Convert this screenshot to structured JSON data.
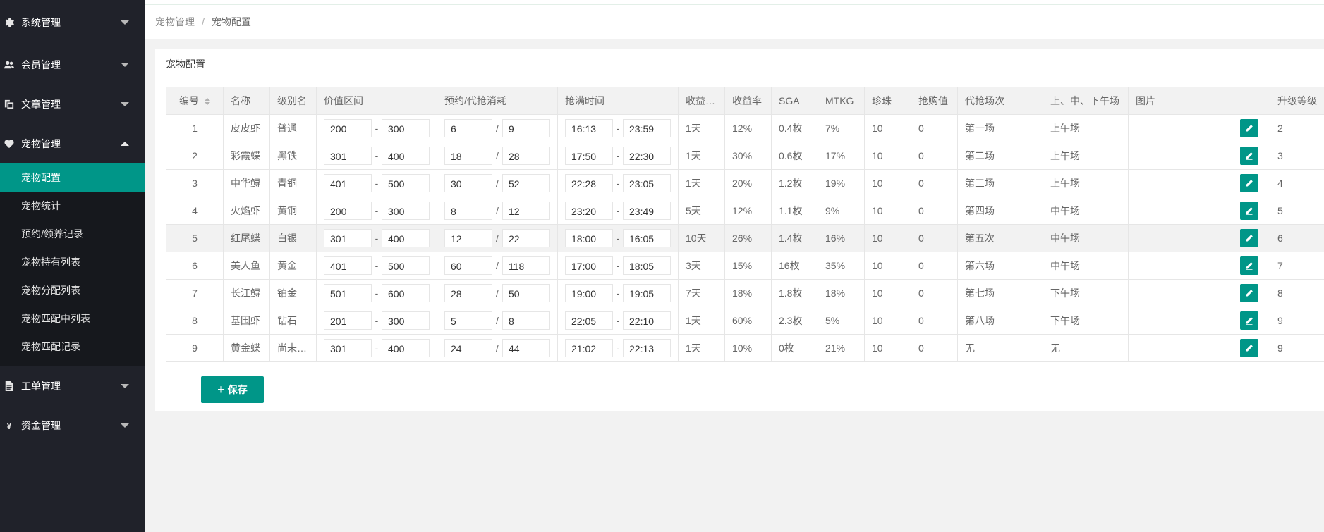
{
  "sidebar": {
    "groups": [
      {
        "label": "系统管理",
        "icon": "gear-icon"
      },
      {
        "label": "会员管理",
        "icon": "users-icon"
      },
      {
        "label": "文章管理",
        "icon": "copy-icon"
      },
      {
        "label": "宠物管理",
        "icon": "heart-icon"
      },
      {
        "label": "工单管理",
        "icon": "file-icon"
      },
      {
        "label": "资金管理",
        "icon": "yen-icon",
        "glyph": "¥"
      }
    ],
    "pet_submenu": [
      {
        "label": "宠物配置",
        "active": true
      },
      {
        "label": "宠物统计"
      },
      {
        "label": "预约/领养记录"
      },
      {
        "label": "宠物持有列表"
      },
      {
        "label": "宠物分配列表"
      },
      {
        "label": "宠物匹配中列表"
      },
      {
        "label": "宠物匹配记录"
      }
    ]
  },
  "breadcrumb": {
    "parent": "宠物管理",
    "separator": "/",
    "current": "宠物配置"
  },
  "card": {
    "title": "宠物配置"
  },
  "table": {
    "headers": [
      "编号",
      "名称",
      "级别名",
      "价值区间",
      "预约/代抢消耗",
      "抢满时间",
      "收益天数",
      "收益率",
      "SGA",
      "MTKG",
      "珍珠",
      "抢购值",
      "代抢场次",
      "上、中、下午场",
      "图片",
      "升级等级"
    ],
    "rows": [
      {
        "id": "1",
        "name": "皮皮虾",
        "level": "普通",
        "vmin": "200",
        "vmax": "300",
        "c1": "6",
        "c2": "9",
        "t1": "16:13",
        "t2": "23:59",
        "days": "1天",
        "rate": "12%",
        "sga": "0.4枚",
        "mtkg": "7%",
        "pearl": "10",
        "buy": "0",
        "round": "第一场",
        "period": "上午场",
        "up": "2"
      },
      {
        "id": "2",
        "name": "彩霞蝶",
        "level": "黑铁",
        "vmin": "301",
        "vmax": "400",
        "c1": "18",
        "c2": "28",
        "t1": "17:50",
        "t2": "22:30",
        "days": "1天",
        "rate": "30%",
        "sga": "0.6枚",
        "mtkg": "17%",
        "pearl": "10",
        "buy": "0",
        "round": "第二场",
        "period": "上午场",
        "up": "3"
      },
      {
        "id": "3",
        "name": "中华鲟",
        "level": "青铜",
        "vmin": "401",
        "vmax": "500",
        "c1": "30",
        "c2": "52",
        "t1": "22:28",
        "t2": "23:05",
        "days": "1天",
        "rate": "20%",
        "sga": "1.2枚",
        "mtkg": "19%",
        "pearl": "10",
        "buy": "0",
        "round": "第三场",
        "period": "上午场",
        "up": "4"
      },
      {
        "id": "4",
        "name": "火焰虾",
        "level": "黄铜",
        "vmin": "200",
        "vmax": "300",
        "c1": "8",
        "c2": "12",
        "t1": "23:20",
        "t2": "23:49",
        "days": "5天",
        "rate": "12%",
        "sga": "1.1枚",
        "mtkg": "9%",
        "pearl": "10",
        "buy": "0",
        "round": "第四场",
        "period": "中午场",
        "up": "5"
      },
      {
        "id": "5",
        "name": "红尾蝶",
        "level": "白银",
        "vmin": "301",
        "vmax": "400",
        "c1": "12",
        "c2": "22",
        "t1": "18:00",
        "t2": "16:05",
        "days": "10天",
        "rate": "26%",
        "sga": "1.4枚",
        "mtkg": "16%",
        "pearl": "10",
        "buy": "0",
        "round": "第五次",
        "period": "中午场",
        "up": "6"
      },
      {
        "id": "6",
        "name": "美人鱼",
        "level": "黄金",
        "vmin": "401",
        "vmax": "500",
        "c1": "60",
        "c2": "118",
        "t1": "17:00",
        "t2": "18:05",
        "days": "3天",
        "rate": "15%",
        "sga": "16枚",
        "mtkg": "35%",
        "pearl": "10",
        "buy": "0",
        "round": "第六场",
        "period": "中午场",
        "up": "7"
      },
      {
        "id": "7",
        "name": "长江鲟",
        "level": "铂金",
        "vmin": "501",
        "vmax": "600",
        "c1": "28",
        "c2": "50",
        "t1": "19:00",
        "t2": "19:05",
        "days": "7天",
        "rate": "18%",
        "sga": "1.8枚",
        "mtkg": "18%",
        "pearl": "10",
        "buy": "0",
        "round": "第七场",
        "period": "下午场",
        "up": "8"
      },
      {
        "id": "8",
        "name": "基围虾",
        "level": "钻石",
        "vmin": "201",
        "vmax": "300",
        "c1": "5",
        "c2": "8",
        "t1": "22:05",
        "t2": "22:10",
        "days": "1天",
        "rate": "60%",
        "sga": "2.3枚",
        "mtkg": "5%",
        "pearl": "10",
        "buy": "0",
        "round": "第八场",
        "period": "下午场",
        "up": "9"
      },
      {
        "id": "9",
        "name": "黄金蝶",
        "level": "尚未…",
        "vmin": "301",
        "vmax": "400",
        "c1": "24",
        "c2": "44",
        "t1": "21:02",
        "t2": "22:13",
        "days": "1天",
        "rate": "10%",
        "sga": "0枚",
        "mtkg": "21%",
        "pearl": "10",
        "buy": "0",
        "round": "无",
        "period": "无",
        "up": "9"
      }
    ],
    "range_sep": "-",
    "cost_sep": "/",
    "highlight_row": 4
  },
  "save_button": {
    "icon": "plus-icon",
    "label": "保存"
  },
  "colors": {
    "accent": "#009688",
    "sidebar_bg": "#20222a",
    "submenu_bg": "#16181d"
  }
}
